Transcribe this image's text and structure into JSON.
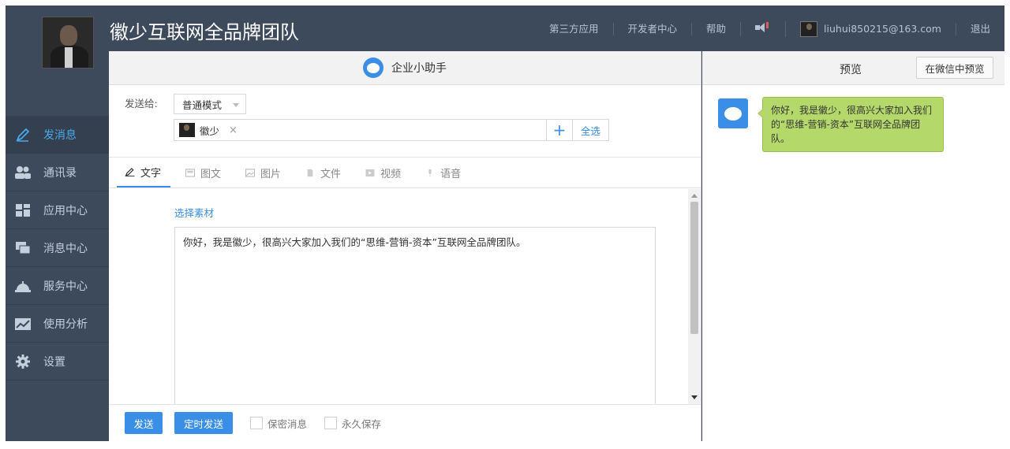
{
  "header": {
    "brand": "徽少互联网全品牌团队",
    "nav": [
      "第三方应用",
      "开发者中心",
      "帮助"
    ],
    "user_email": "liuhui850215@163.com",
    "logout": "退出"
  },
  "sidebar": {
    "items": [
      {
        "label": "发消息",
        "icon": "pencil-icon",
        "active": true
      },
      {
        "label": "通讯录",
        "icon": "contacts-icon",
        "active": false
      },
      {
        "label": "应用中心",
        "icon": "apps-icon",
        "active": false
      },
      {
        "label": "消息中心",
        "icon": "messages-icon",
        "active": false
      },
      {
        "label": "服务中心",
        "icon": "service-bell-icon",
        "active": false
      },
      {
        "label": "使用分析",
        "icon": "analytics-icon",
        "active": false
      },
      {
        "label": "设置",
        "icon": "gear-icon",
        "active": false
      }
    ]
  },
  "main": {
    "title": "企业小助手",
    "send_to_label": "发送给:",
    "mode": "普通模式",
    "recipient": "徽少",
    "remove": "×",
    "add": "+",
    "select_all": "全选",
    "tabs": [
      {
        "label": "文字",
        "icon": "pencil-icon",
        "active": true
      },
      {
        "label": "图文",
        "icon": "article-icon",
        "active": false
      },
      {
        "label": "图片",
        "icon": "image-icon",
        "active": false
      },
      {
        "label": "文件",
        "icon": "file-icon",
        "active": false
      },
      {
        "label": "视频",
        "icon": "video-icon",
        "active": false
      },
      {
        "label": "语音",
        "icon": "microphone-icon",
        "active": false
      }
    ],
    "pick_material": "选择素材",
    "message": "你好，我是徽少，很高兴大家加入我们的“思维-营销-资本”互联网全品牌团队。",
    "send": "发送",
    "timed_send": "定时发送",
    "secret": "保密消息",
    "keep_forever": "永久保存"
  },
  "preview": {
    "title": "预览",
    "preview_in_wechat": "在微信中预览",
    "bubble": "你好，我是徽少，很高兴大家加入我们的“思维-营销-资本”互联网全品牌团队。"
  },
  "colors": {
    "frame": "#3d4a5b",
    "accent": "#3a8ee6",
    "bubble": "#b5d86b"
  }
}
